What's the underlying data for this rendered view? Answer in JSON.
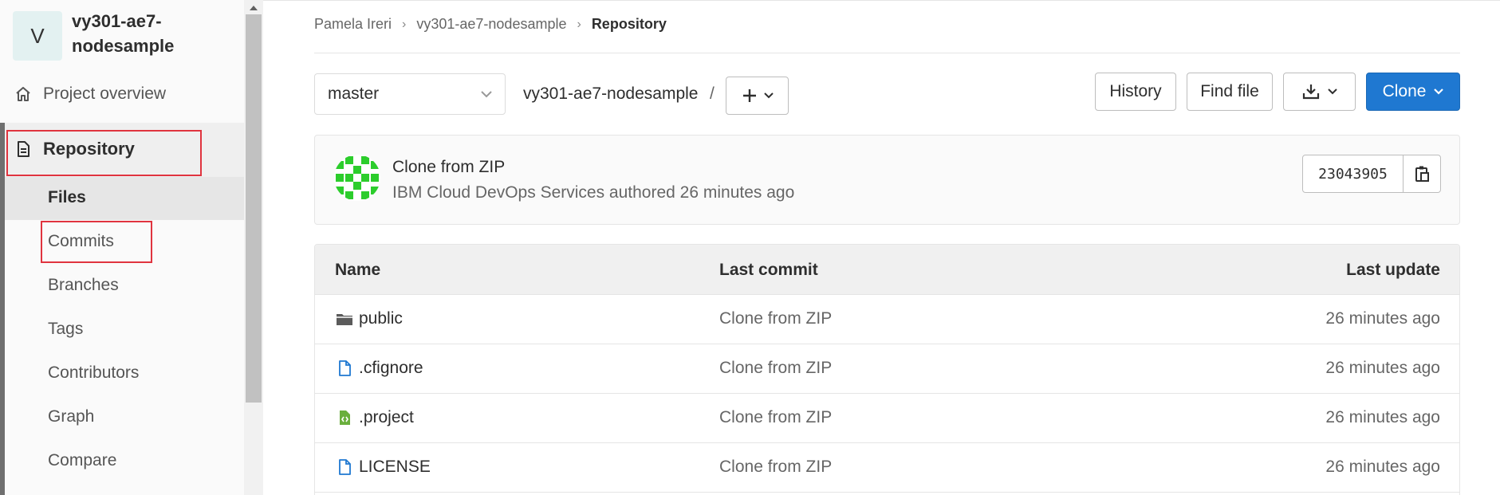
{
  "sidebar": {
    "avatar_letter": "V",
    "project_name": "vy301-ae7-nodesample",
    "overview_label": "Project overview",
    "repository_label": "Repository",
    "sub_items": [
      "Files",
      "Commits",
      "Branches",
      "Tags",
      "Contributors",
      "Graph",
      "Compare"
    ],
    "highlight_color": "#e0343f"
  },
  "breadcrumb": {
    "items": [
      "Pamela Ireri",
      "vy301-ae7-nodesample"
    ],
    "current": "Repository"
  },
  "toolbar": {
    "branch": "master",
    "path": "vy301-ae7-nodesample",
    "path_separator": "/",
    "history_label": "History",
    "find_file_label": "Find file",
    "clone_label": "Clone",
    "clone_color": "#1f78d1"
  },
  "last_commit": {
    "title": "Clone from ZIP",
    "meta": "IBM Cloud DevOps Services authored 26 minutes ago",
    "sha": "23043905"
  },
  "file_tree": {
    "headers": {
      "name": "Name",
      "last_commit": "Last commit",
      "last_update": "Last update"
    },
    "rows": [
      {
        "icon": "folder-icon",
        "name": "public",
        "commit": "Clone from ZIP",
        "updated": "26 minutes ago"
      },
      {
        "icon": "file-icon",
        "name": ".cfignore",
        "commit": "Clone from ZIP",
        "updated": "26 minutes ago"
      },
      {
        "icon": "code-file-icon",
        "name": ".project",
        "commit": "Clone from ZIP",
        "updated": "26 minutes ago"
      },
      {
        "icon": "file-icon",
        "name": "LICENSE",
        "commit": "Clone from ZIP",
        "updated": "26 minutes ago"
      }
    ]
  }
}
